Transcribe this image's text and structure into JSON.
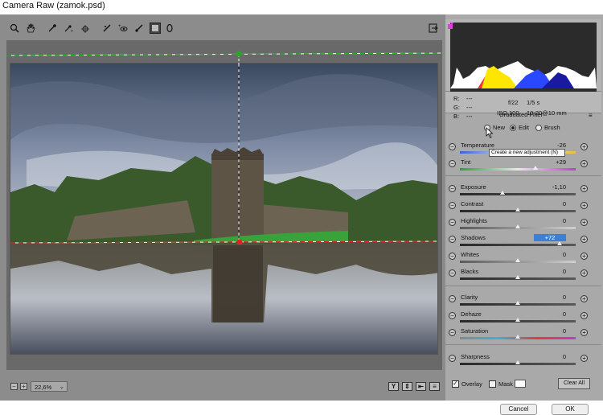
{
  "window": {
    "title": "Camera Raw (zamok.psd)"
  },
  "toolbar": {
    "tools": [
      "zoom-icon",
      "hand-icon",
      "white-balance-icon",
      "color-sampler-icon",
      "target-adjust-icon",
      "straighten-icon",
      "red-eye-icon",
      "brush-icon",
      "graduated-filter-icon",
      "radial-filter-icon"
    ]
  },
  "statusbar": {
    "zoom": "22,6%"
  },
  "readout": {
    "r_label": "R:",
    "r_value": "---",
    "g_label": "G:",
    "g_value": "---",
    "b_label": "B:",
    "b_value": "---",
    "aperture": "f/22",
    "shutter": "1/5 s",
    "iso": "ISO 100",
    "lens": "10-20@10 mm"
  },
  "panel": {
    "title": "Graduated Filter",
    "modes": [
      "New",
      "Edit",
      "Brush"
    ],
    "active_mode": "Edit",
    "tooltip": "Create a new adjustment (N)"
  },
  "sliders": [
    {
      "label": "Temperature",
      "value": "-26",
      "level": 0.43,
      "track": "temp"
    },
    {
      "label": "Tint",
      "value": "+29",
      "level": 0.65,
      "track": "tint"
    },
    {
      "label": "Exposure",
      "value": "-1,10",
      "level": 0.37,
      "track": "dark"
    },
    {
      "label": "Contrast",
      "value": "0",
      "level": 0.5,
      "track": "dark"
    },
    {
      "label": "Highlights",
      "value": "0",
      "level": 0.5,
      "track": "light"
    },
    {
      "label": "Shadows",
      "value": "+72",
      "level": 0.86,
      "track": "dark",
      "selected": true
    },
    {
      "label": "Whites",
      "value": "0",
      "level": 0.5,
      "track": "light"
    },
    {
      "label": "Blacks",
      "value": "0",
      "level": 0.5,
      "track": "dark"
    },
    {
      "label": "Clarity",
      "value": "0",
      "level": 0.5,
      "track": "dark"
    },
    {
      "label": "Dehaze",
      "value": "0",
      "level": 0.5,
      "track": "dark"
    },
    {
      "label": "Saturation",
      "value": "0",
      "level": 0.5,
      "track": "sat"
    },
    {
      "label": "Sharpness",
      "value": "0",
      "level": 0.5,
      "track": "dark"
    }
  ],
  "footer": {
    "overlay": "Overlay",
    "overlay_checked": true,
    "mask": "Mask",
    "mask_checked": false,
    "clear_all": "Clear All"
  },
  "bottom": {
    "cancel": "Cancel",
    "ok": "OK"
  },
  "colors": {
    "guide_green": "#22aa22",
    "guide_red": "#dd2222",
    "selection": "#3d7fd3"
  }
}
